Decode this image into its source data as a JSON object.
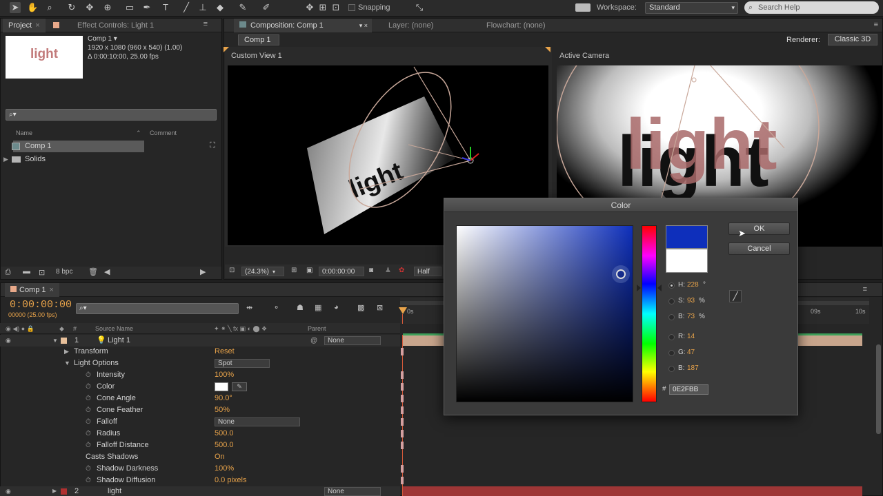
{
  "toolbar": {
    "snapping_label": "Snapping",
    "workspace_label": "Workspace:",
    "workspace_value": "Standard",
    "search_placeholder": "Search Help"
  },
  "project_panel": {
    "tab_project": "Project",
    "tab_effect_controls": "Effect Controls: Light 1",
    "thumb_text": "light",
    "comp_name": "Comp 1 ▾",
    "comp_res": "1920 x 1080  (960 x 540) (1.00)",
    "comp_dur": "Δ 0:00:10:00, 25.00 fps",
    "search_text": "⌕▾",
    "col_name": "Name",
    "col_comment": "Comment",
    "items": [
      {
        "label": "Comp 1"
      },
      {
        "label": "Solids"
      }
    ],
    "bpc": "8 bpc"
  },
  "composition_panel": {
    "tab_composition": "Composition: Comp 1",
    "tab_layer": "Layer: (none)",
    "tab_flowchart": "Flowchart: (none)",
    "comp_button": "Comp 1",
    "renderer_label": "Renderer:",
    "renderer_value": "Classic 3D",
    "view_left": "Custom View 1",
    "view_right": "Active Camera",
    "viewer_text": "light",
    "zoom": "(24.3%)",
    "timecode": "0:00:00:00",
    "resolution": "Half"
  },
  "timeline": {
    "tab": "Comp 1",
    "timecode": "0:00:00:00",
    "fps": "00000 (25.00 fps)",
    "search_text": "⌕▾",
    "col_source_name": "Source Name",
    "col_parent": "Parent",
    "ruler_marks": [
      "0s",
      "09s",
      "10s"
    ],
    "layers": [
      {
        "num": "1",
        "name": "Light 1",
        "parent": "None"
      },
      {
        "num": "2",
        "name": "light",
        "parent": "None"
      }
    ],
    "properties": [
      {
        "name": "Transform",
        "value": "Reset"
      },
      {
        "name": "Light Options",
        "value": "Spot"
      },
      {
        "name": "Intensity",
        "value": "100%"
      },
      {
        "name": "Color",
        "value": ""
      },
      {
        "name": "Cone Angle",
        "value": "90.0°"
      },
      {
        "name": "Cone Feather",
        "value": "50%"
      },
      {
        "name": "Falloff",
        "value": "None"
      },
      {
        "name": "Radius",
        "value": "500.0"
      },
      {
        "name": "Falloff Distance",
        "value": "500.0"
      },
      {
        "name": "Casts Shadows",
        "value": "On"
      },
      {
        "name": "Shadow Darkness",
        "value": "100%"
      },
      {
        "name": "Shadow Diffusion",
        "value": "0.0 pixels"
      }
    ]
  },
  "color_dialog": {
    "title": "Color",
    "ok_label": "OK",
    "cancel_label": "Cancel",
    "h_label": "H:",
    "h_value": "228",
    "h_unit": "°",
    "s_label": "S:",
    "s_value": "93",
    "s_unit": "%",
    "b_label": "B:",
    "b_value": "73",
    "b_unit": "%",
    "r_label": "R:",
    "r_value": "14",
    "g_label": "G:",
    "g_value": "47",
    "bl_label": "B:",
    "bl_value": "187",
    "hex_label": "#",
    "hex_value": "0E2FBB",
    "current_color": "#0e2fbb",
    "previous_color": "#ffffff"
  },
  "colors": {
    "accent_orange": "#e8a34a",
    "panel_bg": "#262626",
    "light_text": "#c27b7b"
  }
}
